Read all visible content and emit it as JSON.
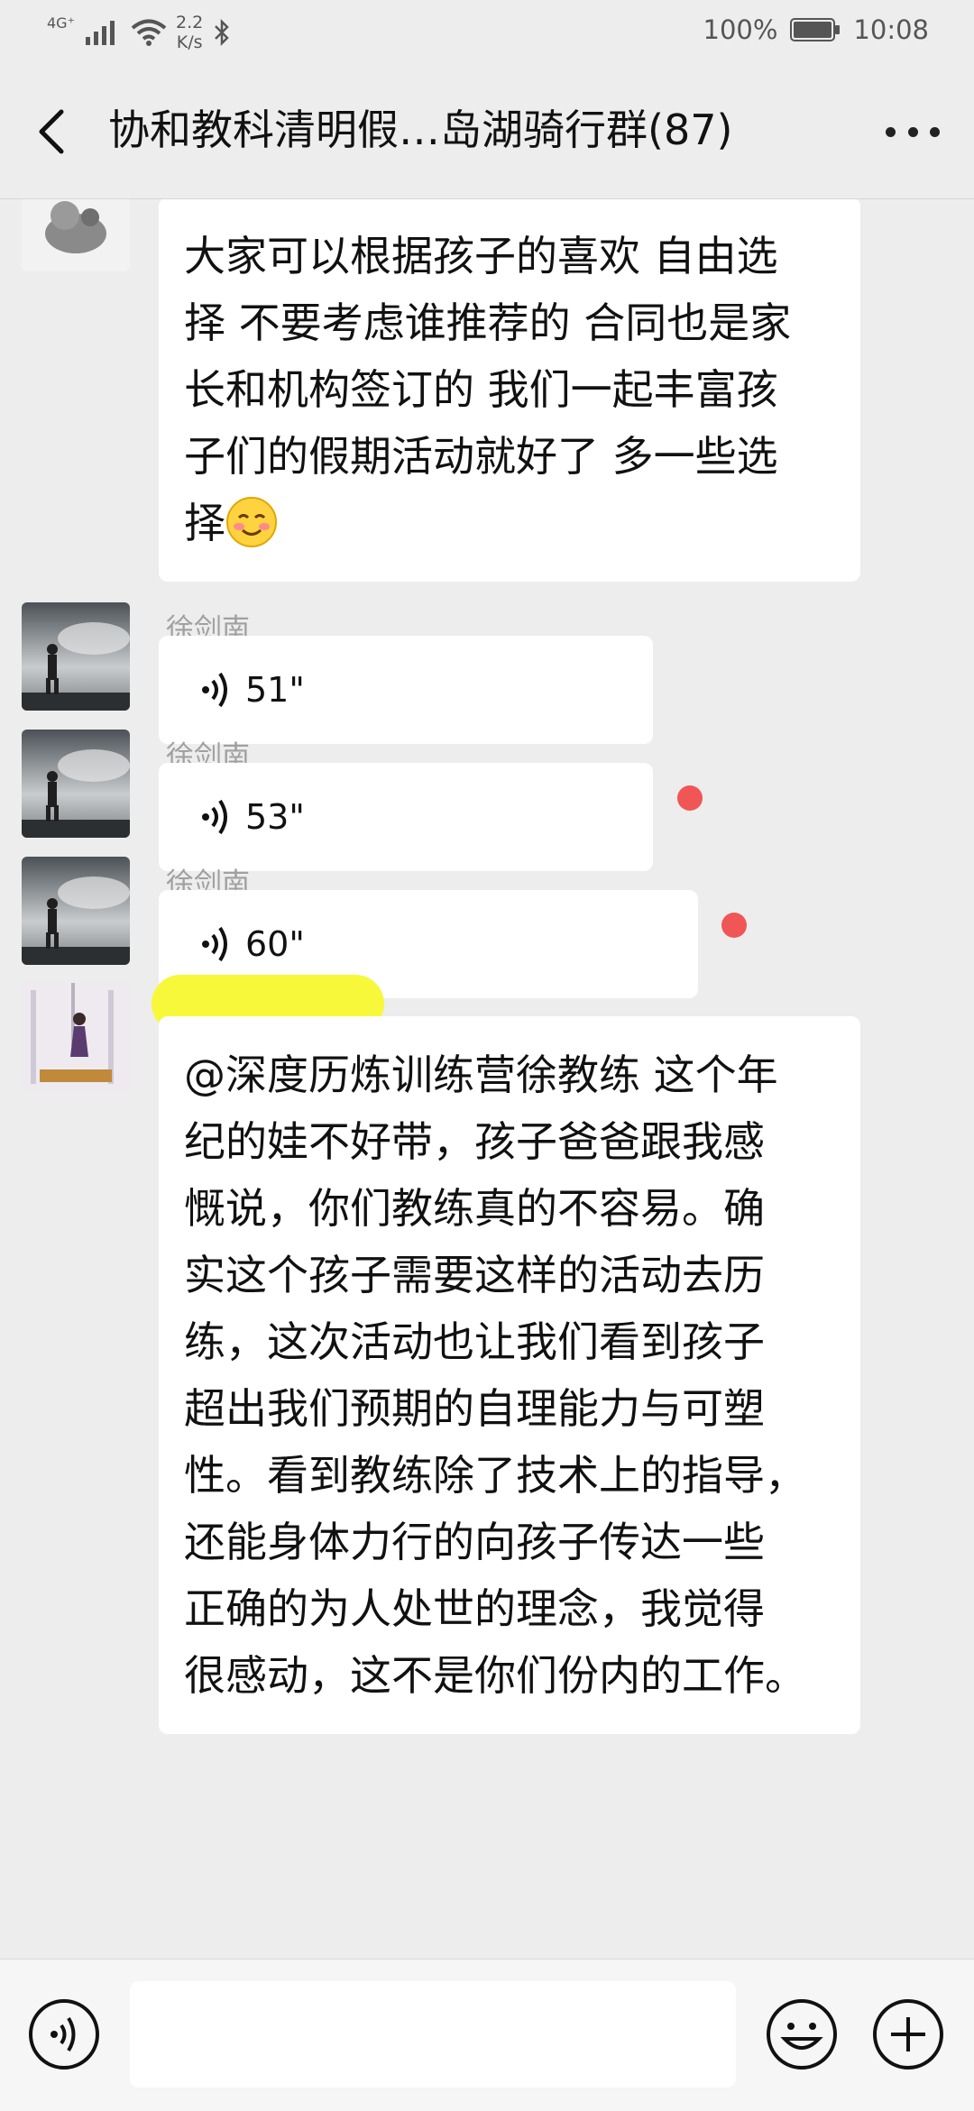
{
  "status_bar": {
    "network": "4G⁺",
    "speed_value": "2.2",
    "speed_unit": "K/s",
    "battery": "100%",
    "time": "10:08"
  },
  "header": {
    "title": "协和教科清明假…岛湖骑行群(87)"
  },
  "messages": [
    {
      "type": "text",
      "lines": [
        "大家可以根据孩子的喜欢  自由选",
        "择 不要考虑谁推荐的 合同也是家",
        "长和机构签订的  我们一起丰富孩",
        "子们的假期活动就好了 多一些选",
        "择"
      ],
      "emoji": "smiling-face"
    },
    {
      "type": "voice",
      "sender": "徐剑南",
      "duration": "51\"",
      "unread": false
    },
    {
      "type": "voice",
      "sender": "徐剑南",
      "duration": "53\"",
      "unread": true
    },
    {
      "type": "voice",
      "sender": "徐剑南",
      "duration": "60\"",
      "unread": true
    },
    {
      "type": "text",
      "sender_redacted": true,
      "lines": [
        "@深度历炼训练营徐教练  这个年",
        "纪的娃不好带，孩子爸爸跟我感",
        "慨说，你们教练真的不容易。确",
        "实这个孩子需要这样的活动去历",
        "练，这次活动也让我们看到孩子",
        "超出我们预期的自理能力与可塑",
        "性。看到教练除了技术上的指导，",
        "还能身体力行的向孩子传达一些",
        "正确的为人处世的理念，我觉得",
        "很感动，这不是你们份内的工作。"
      ]
    }
  ],
  "input_bar": {
    "voice_icon": "voice-input-icon",
    "emoji_icon": "emoji-icon",
    "plus_icon": "plus-icon"
  },
  "colors": {
    "background": "#ededed",
    "bubble": "#ffffff",
    "unread_dot": "#f15656",
    "redaction": "#f7f83a"
  }
}
